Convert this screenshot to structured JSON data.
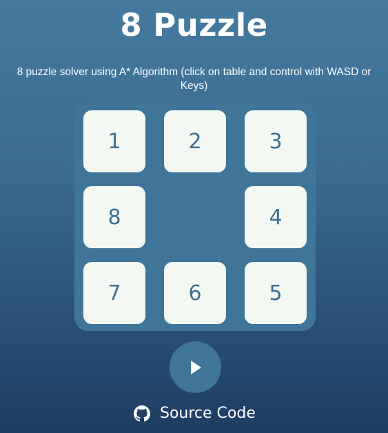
{
  "header": {
    "title": "8 Puzzle",
    "subtitle": "8 puzzle solver using A* Algorithm (click on table and control with WASD or Keys)"
  },
  "board": {
    "rows": 3,
    "cols": 3,
    "tiles": [
      "1",
      "2",
      "3",
      "8",
      "",
      "4",
      "7",
      "6",
      "5"
    ]
  },
  "controls": {
    "play_icon": "play-icon"
  },
  "footer": {
    "source_label": "Source Code",
    "source_icon": "github-icon"
  },
  "colors": {
    "tile_background": "#f3f9f2",
    "tile_text": "#3d6f92",
    "board_background": "#3f7599"
  }
}
